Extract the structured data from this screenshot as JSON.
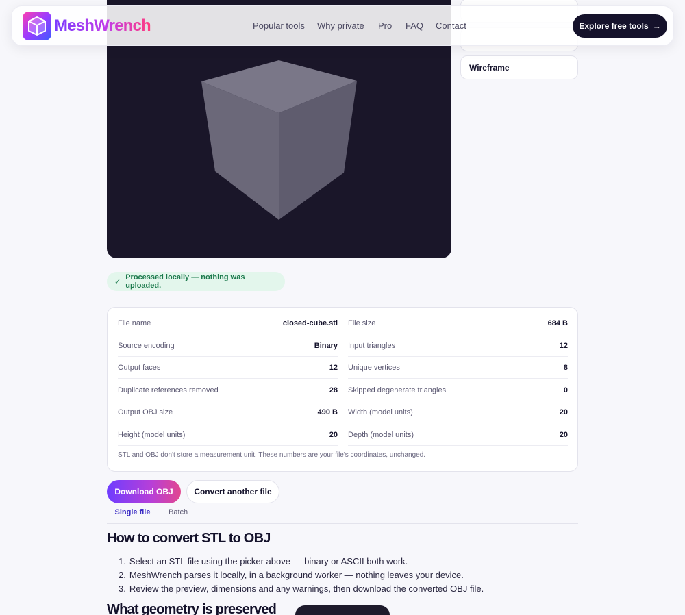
{
  "header": {
    "brand": "MeshWrench",
    "nav": [
      "Popular tools",
      "Why private",
      "Pro",
      "FAQ",
      "Contact"
    ],
    "cta_label": "Explore free tools",
    "cta_arrow": "→"
  },
  "viewer": {
    "view_buttons": [
      "",
      "",
      "Wireframe"
    ]
  },
  "status": {
    "check": "✓",
    "message": "Processed locally — nothing was uploaded."
  },
  "stats": {
    "items": [
      {
        "label": "File name",
        "value": "closed-cube.stl"
      },
      {
        "label": "File size",
        "value": "684 B"
      },
      {
        "label": "Source encoding",
        "value": "Binary"
      },
      {
        "label": "Input triangles",
        "value": "12"
      },
      {
        "label": "Output faces",
        "value": "12"
      },
      {
        "label": "Unique vertices",
        "value": "8"
      },
      {
        "label": "Duplicate references removed",
        "value": "28"
      },
      {
        "label": "Skipped degenerate triangles",
        "value": "0"
      },
      {
        "label": "Output OBJ size",
        "value": "490 B"
      },
      {
        "label": "Width (model units)",
        "value": "20"
      },
      {
        "label": "Height (model units)",
        "value": "20"
      },
      {
        "label": "Depth (model units)",
        "value": "20"
      }
    ],
    "note": "STL and OBJ don't store a measurement unit. These numbers are your file's coordinates, unchanged."
  },
  "actions": {
    "download_label": "Download OBJ",
    "convert_label": "Convert another file"
  },
  "tabs": [
    "Single file",
    "Batch"
  ],
  "howto": {
    "title": "How to convert STL to OBJ",
    "steps": [
      "Select an STL file using the picker above — binary or ASCII both work.",
      "MeshWrench parses it locally, in a background worker — nothing leaves your device.",
      "Review the preview, dimensions and any warnings, then download the converted OBJ file."
    ]
  },
  "geometry": {
    "title": "What geometry is preserved"
  },
  "colors": {
    "viewer_bg": "#1a1629",
    "cube_top": "#7a7788",
    "cube_left": "#6b6879",
    "cube_right": "#5f5c6e",
    "accent": "#5a3cff",
    "success_bg": "#e3f6ec",
    "success_text": "#1c7a4d"
  }
}
